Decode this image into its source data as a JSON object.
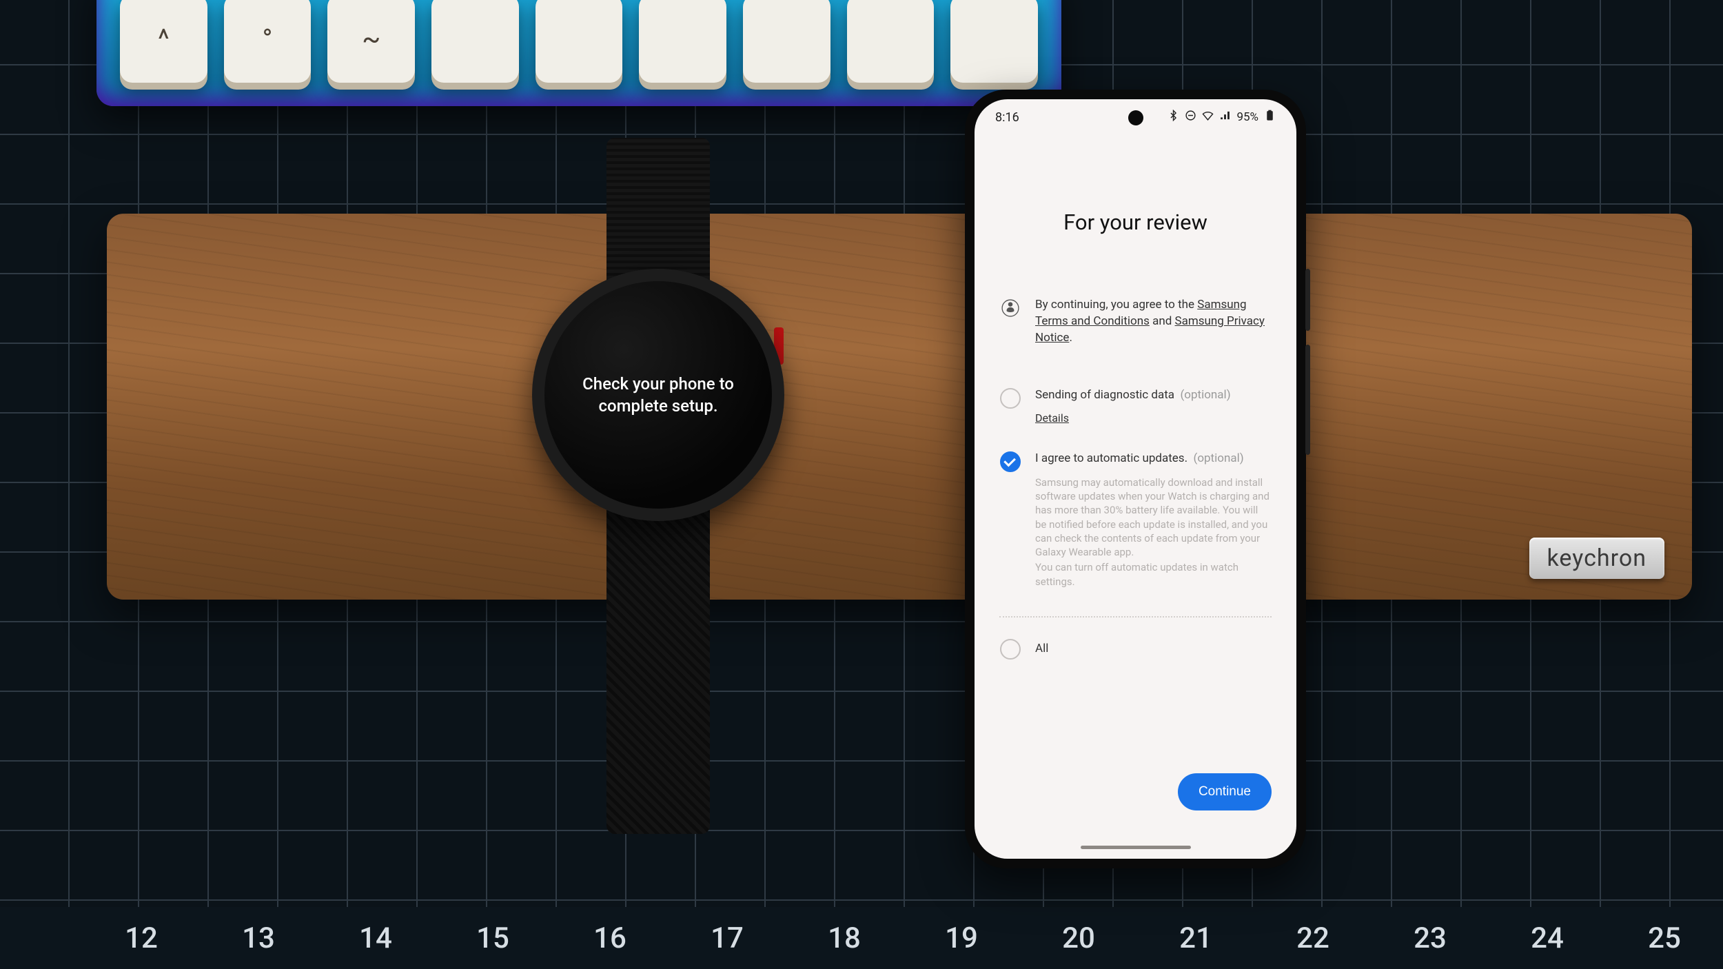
{
  "mat": {
    "ruler": [
      "12",
      "13",
      "14",
      "15",
      "16",
      "17",
      "18",
      "19",
      "20",
      "21",
      "22",
      "23",
      "24",
      "25"
    ]
  },
  "keyboard": {
    "keys": [
      "^",
      "°",
      "~",
      "",
      "",
      "",
      "",
      "",
      ""
    ]
  },
  "wood": {
    "badge": "keychron"
  },
  "watch": {
    "message": "Check your phone to complete setup."
  },
  "phone": {
    "status": {
      "time": "8:16",
      "battery": "95%"
    },
    "title": "For your review",
    "terms": {
      "prefix": "By continuing, you agree to the ",
      "link1": "Samsung Terms and Conditions",
      "mid": " and ",
      "link2": "Samsung Privacy Notice",
      "suffix": "."
    },
    "diag": {
      "label": "Sending of diagnostic data",
      "optional": "(optional)",
      "details": "Details",
      "checked": false
    },
    "updates": {
      "label": "I agree to automatic updates.",
      "optional": "(optional)",
      "checked": true,
      "desc1": "Samsung may automatically download and install software updates when your Watch is charging and has more than 30% battery life available. You will be notified before each update is installed, and you can check the contents of each update from your Galaxy Wearable app.",
      "desc2": "You can turn off automatic updates in watch settings."
    },
    "all": {
      "label": "All",
      "checked": false
    },
    "cta": "Continue"
  }
}
